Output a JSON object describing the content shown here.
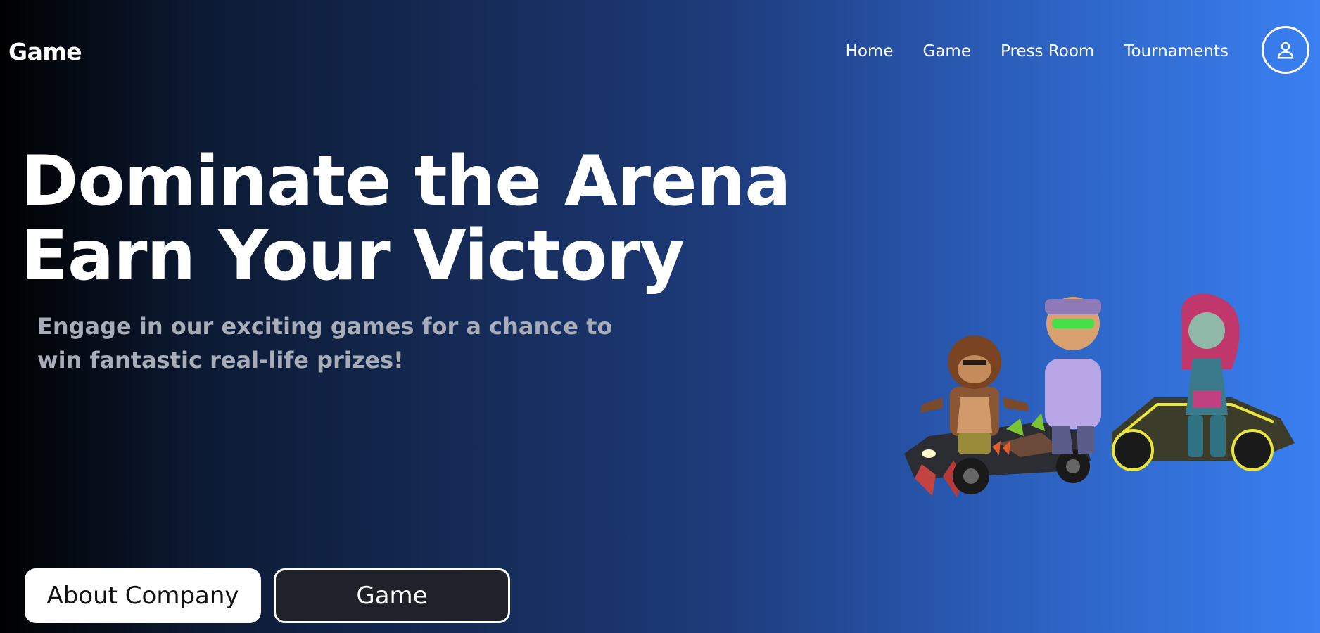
{
  "header": {
    "brand": "Game",
    "nav": [
      {
        "label": "Home"
      },
      {
        "label": "Game"
      },
      {
        "label": "Press Room"
      },
      {
        "label": "Tournaments"
      }
    ],
    "profile_icon": "user-icon"
  },
  "hero": {
    "title_line1": "Dominate the Arena",
    "title_line2": "Earn Your Victory",
    "subtitle": "Engage in our exciting games for a chance to win fantastic real-life prizes!",
    "image_icon": "characters-with-karts-illustration"
  },
  "actions": {
    "about_label": "About Company",
    "game_label": "Game"
  },
  "colors": {
    "gradient_start": "#000000",
    "gradient_end": "#3a80f2",
    "subtitle": "#a7adb8",
    "secondary_button_bg": "#1f2228"
  }
}
